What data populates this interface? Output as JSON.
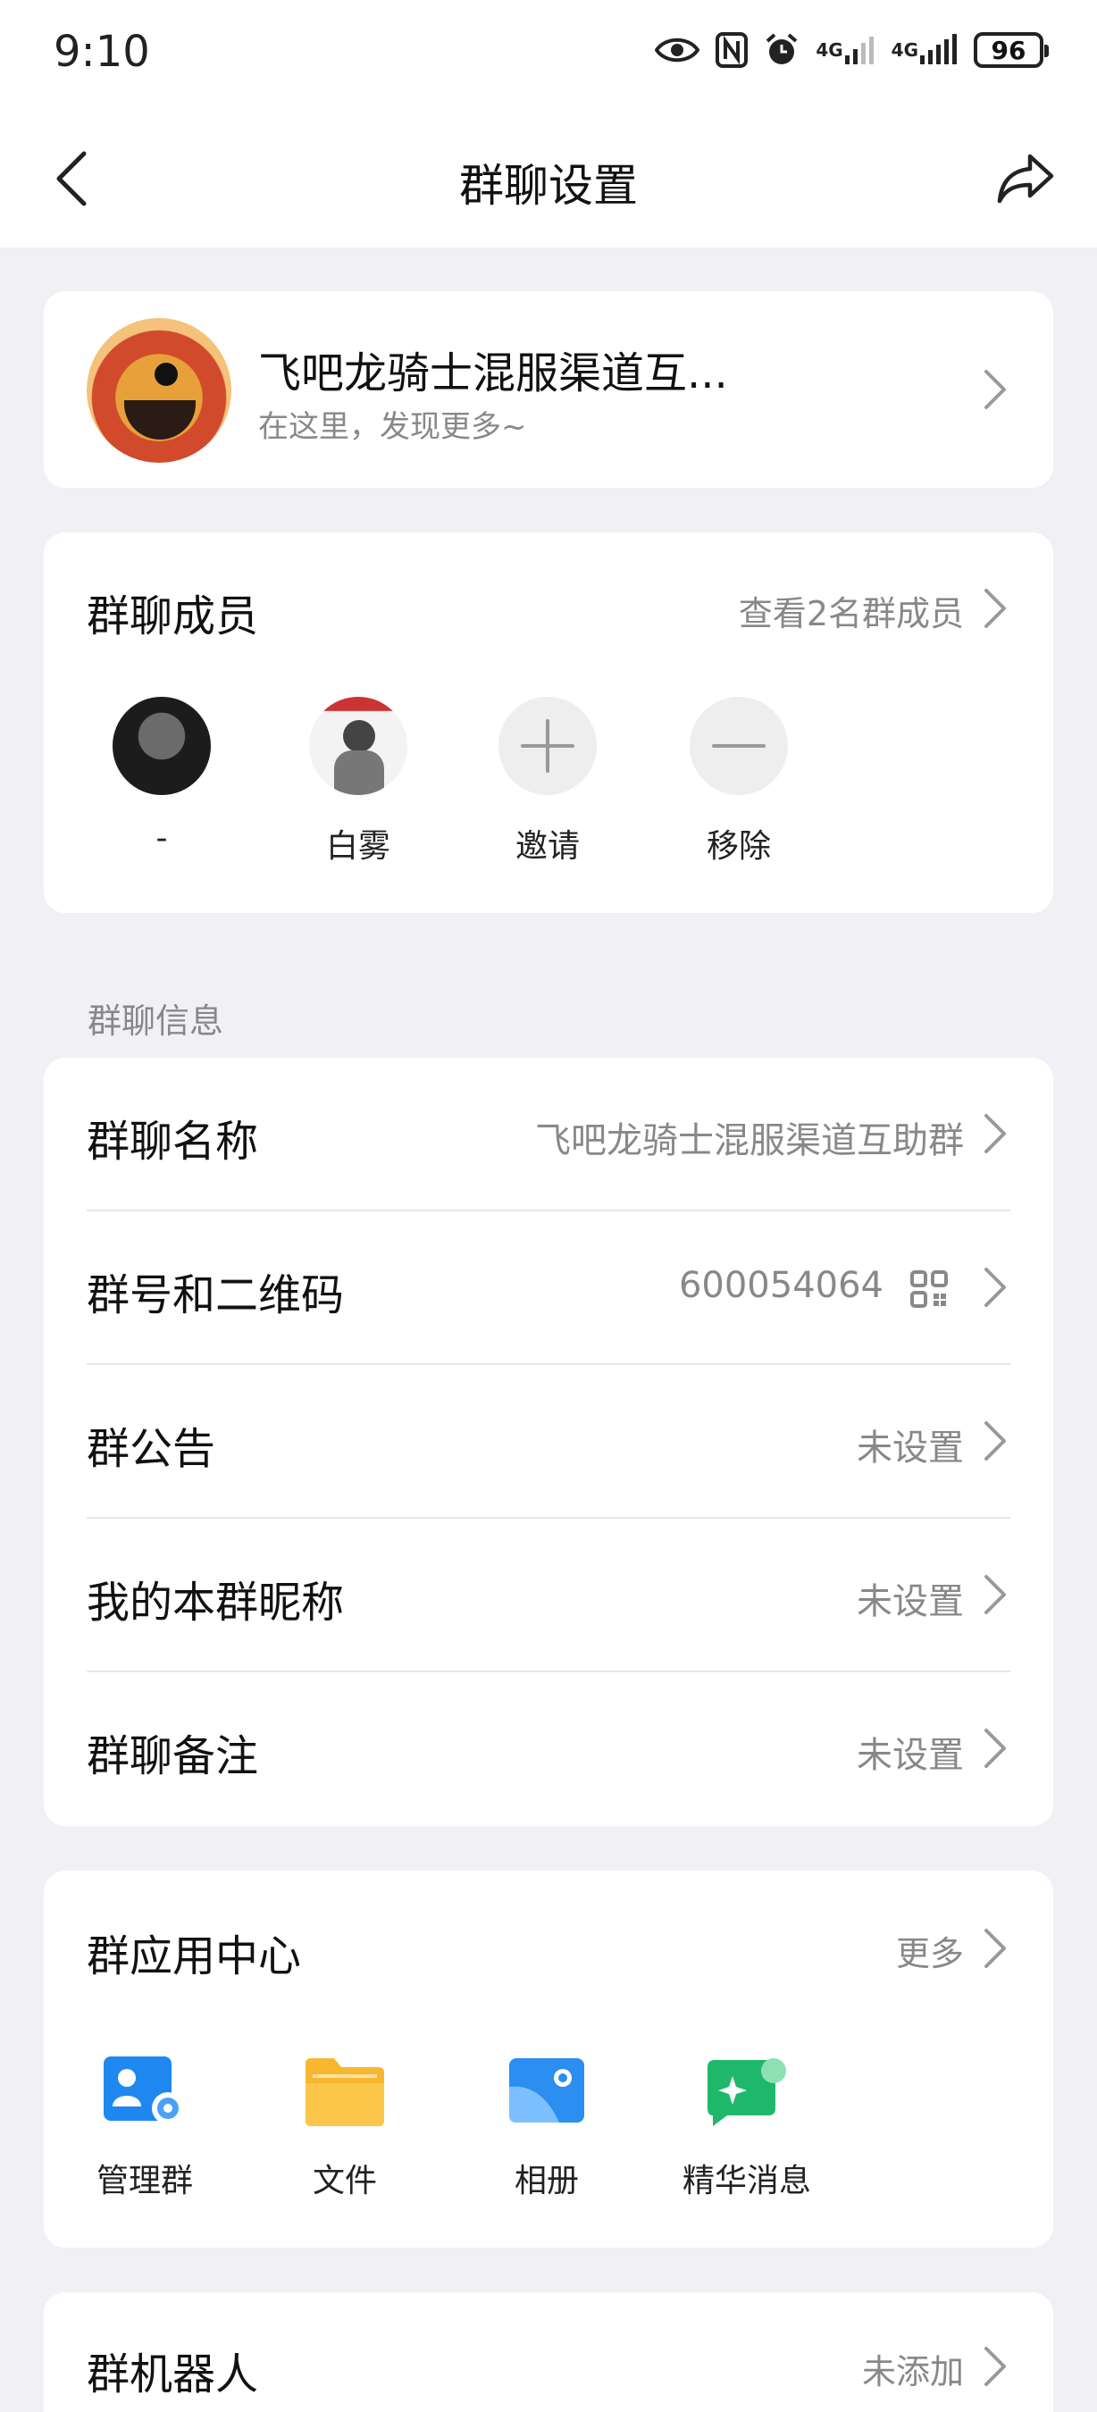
{
  "status_bar": {
    "time": "9:10",
    "battery": "96",
    "network_1": "4G",
    "network_2": "4G"
  },
  "nav": {
    "title": "群聊设置"
  },
  "group": {
    "name": "飞吧龙骑士混服渠道互...",
    "subtitle": "在这里，发现更多~"
  },
  "members": {
    "title": "群聊成员",
    "view_all": "查看2名群成员",
    "list": [
      {
        "name": "-"
      },
      {
        "name": "白雾"
      }
    ],
    "invite_label": "邀请",
    "remove_label": "移除"
  },
  "info_section": {
    "label": "群聊信息",
    "rows": [
      {
        "title": "群聊名称",
        "value": "飞吧龙骑士混服渠道互助群"
      },
      {
        "title": "群号和二维码",
        "value": "600054064"
      },
      {
        "title": "群公告",
        "value": "未设置"
      },
      {
        "title": "我的本群昵称",
        "value": "未设置"
      },
      {
        "title": "群聊备注",
        "value": "未设置"
      }
    ]
  },
  "apps": {
    "title": "群应用中心",
    "more": "更多",
    "items": [
      {
        "label": "管理群",
        "icon": "manage-group-icon",
        "color": "#1e88f0"
      },
      {
        "label": "文件",
        "icon": "folder-icon",
        "color": "#f7b731"
      },
      {
        "label": "相册",
        "icon": "album-icon",
        "color": "#2b8ef0"
      },
      {
        "label": "精华消息",
        "icon": "featured-message-icon",
        "color": "#1fb86b"
      }
    ]
  },
  "bot": {
    "title": "群机器人",
    "value": "未添加"
  }
}
